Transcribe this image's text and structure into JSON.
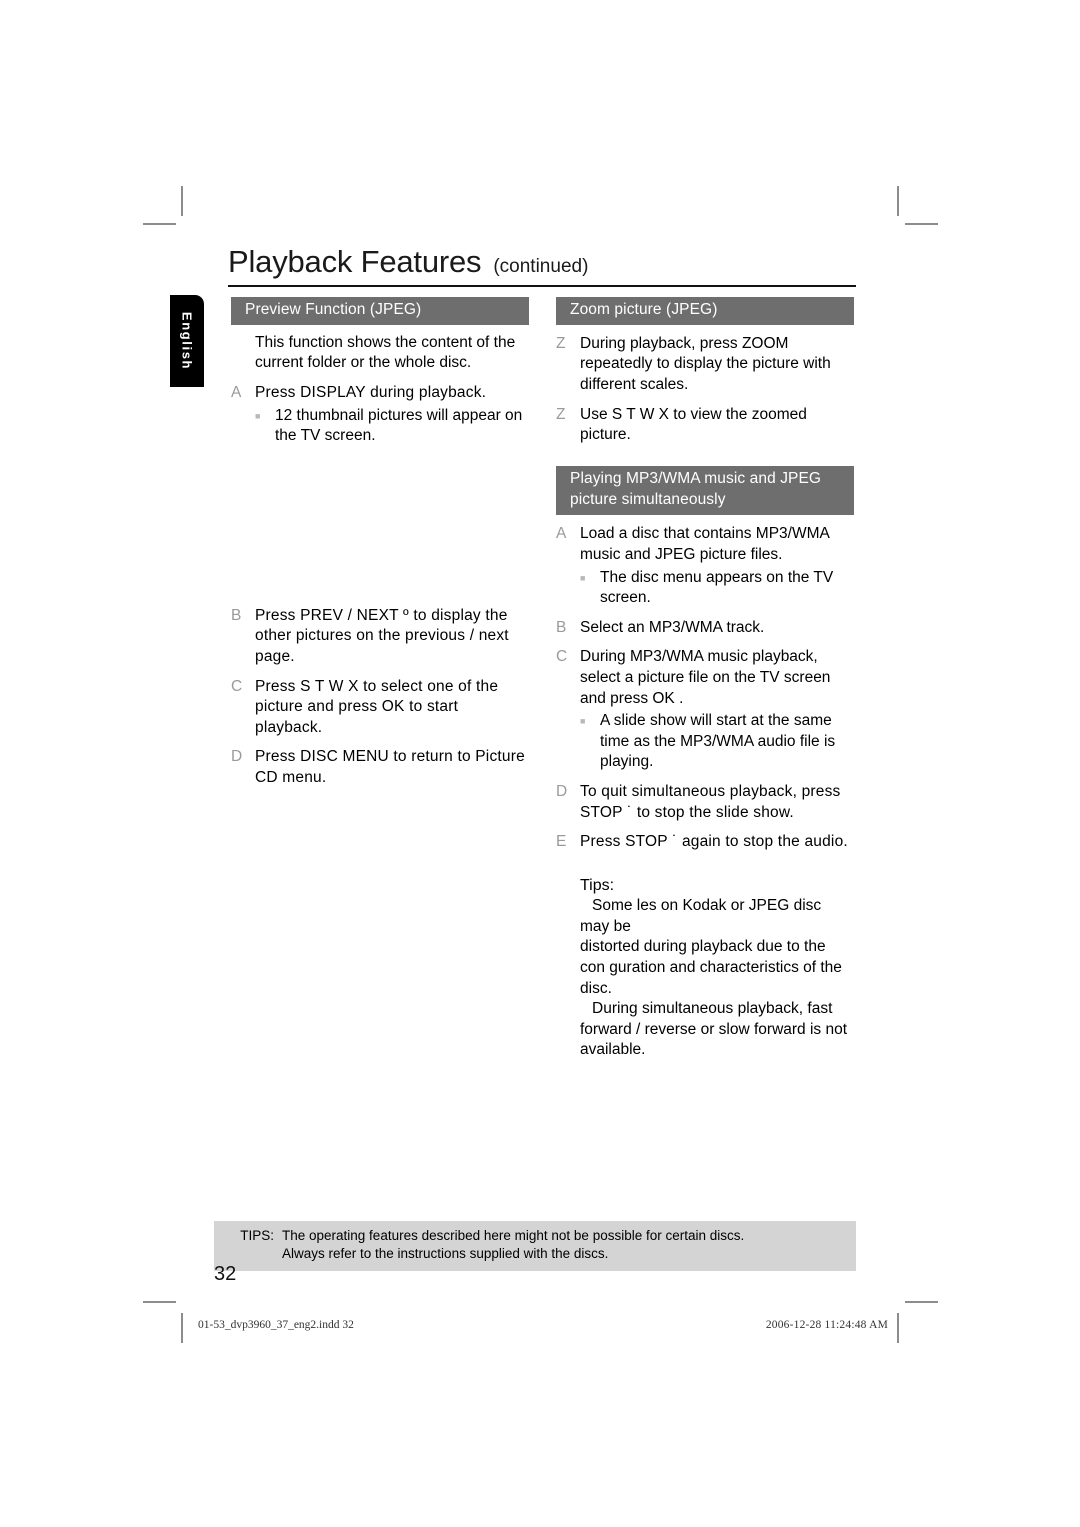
{
  "page": {
    "title": "Playback Features",
    "title_suffix": "(continued)",
    "language_tab": "English",
    "page_number": "32"
  },
  "left_column": {
    "section_title": "Preview Function (JPEG)",
    "intro": "This function shows the content of the current folder or the whole disc.",
    "steps": [
      {
        "marker": "A",
        "text": "Press DISPLAY  during playback.",
        "sub": [
          "12 thumbnail pictures will appear on the TV screen."
        ]
      },
      {
        "marker": "B",
        "text": "Press PREV      / NEXT  º    to display the other pictures on the previous / next page.",
        "sub": []
      },
      {
        "marker": "C",
        "text": "Press  S  T  W X to select one of the picture and press OK  to start playback.",
        "sub": []
      },
      {
        "marker": "D",
        "text": "Press DISC MENU  to return to Picture CD menu.",
        "sub": []
      }
    ]
  },
  "right_column": {
    "zoom_section": {
      "section_title": "Zoom picture (JPEG)",
      "items": [
        {
          "marker": "Z",
          "text": "During playback, press ZOOM repeatedly to display the picture with different scales."
        },
        {
          "marker": "Z",
          "text": "Use  S  T  W X to view the zoomed picture."
        }
      ]
    },
    "mp3_section": {
      "section_title": "Playing MP3/WMA music and JPEG picture simultaneously",
      "steps": [
        {
          "marker": "A",
          "text": "Load a disc that contains MP3/WMA music and JPEG picture files.",
          "sub": [
            "The disc menu appears on the TV screen."
          ]
        },
        {
          "marker": "B",
          "text": "Select an MP3/WMA track.",
          "sub": []
        },
        {
          "marker": "C",
          "text": "During MP3/WMA music playback, select a picture file on the TV screen and press OK .",
          "sub": [
            "A slide show will start at the same time as the MP3/WMA audio file is playing."
          ]
        },
        {
          "marker": "D",
          "text": "To quit simultaneous playback, press STOP  ˙    to stop the slide show.",
          "sub": []
        },
        {
          "marker": "E",
          "text": "Press STOP  ˙     again to stop the audio.",
          "sub": []
        }
      ]
    },
    "tips": {
      "label": "Tips:",
      "lines": [
        "Some  les on Kodak or JPEG disc may be",
        "distorted during playback due to the",
        "con guration and characteristics of the disc.",
        "During simultaneous playback, fast",
        "forward / reverse or slow forward is not",
        "available."
      ]
    }
  },
  "footer_band": {
    "label": "TIPS:",
    "line1": "The operating features described here might not be possible for certain discs.",
    "line2": "Always refer to the instructions supplied with the discs."
  },
  "print_footer": {
    "file": "01-53_dvp3960_37_eng2.indd   32",
    "date": "2006-12-28   11:24:48 AM"
  },
  "colors": {
    "section_bar": "#6e6e6e",
    "tips_band": "#d4d4d4",
    "marker_grey": "#9a9a9a",
    "tab_black": "#000000"
  }
}
